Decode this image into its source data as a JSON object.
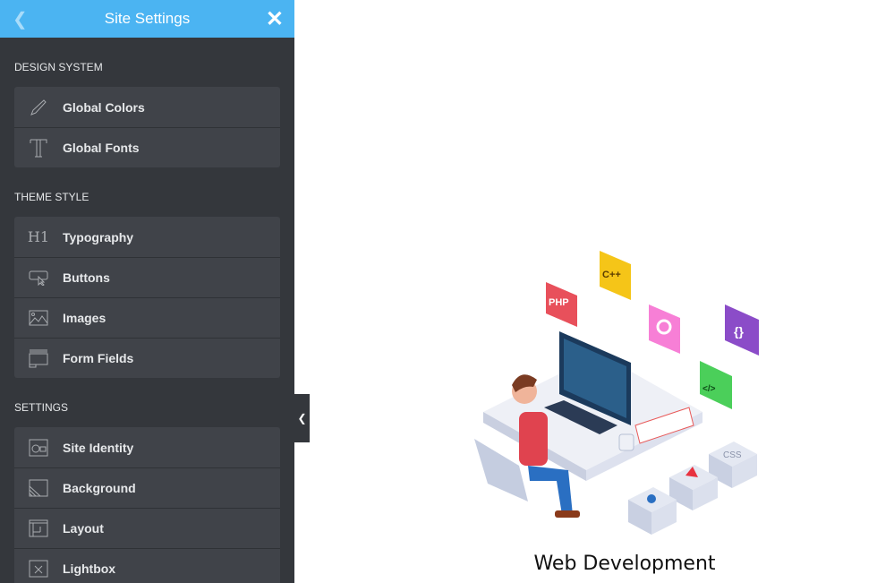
{
  "header": {
    "title": "Site Settings",
    "back_icon": "chevron-left-icon",
    "close_icon": "close-icon"
  },
  "sections": [
    {
      "title": "DESIGN SYSTEM",
      "items": [
        {
          "label": "Global Colors",
          "icon": "brush-icon"
        },
        {
          "label": "Global Fonts",
          "icon": "typeface-icon"
        }
      ]
    },
    {
      "title": "THEME STYLE",
      "items": [
        {
          "label": "Typography",
          "icon": "h1-icon"
        },
        {
          "label": "Buttons",
          "icon": "button-cursor-icon"
        },
        {
          "label": "Images",
          "icon": "image-icon"
        },
        {
          "label": "Form Fields",
          "icon": "form-field-icon"
        }
      ]
    },
    {
      "title": "SETTINGS",
      "items": [
        {
          "label": "Site Identity",
          "icon": "id-card-icon"
        },
        {
          "label": "Background",
          "icon": "background-icon"
        },
        {
          "label": "Layout",
          "icon": "layout-icon"
        },
        {
          "label": "Lightbox",
          "icon": "lightbox-icon"
        }
      ]
    }
  ],
  "main": {
    "caption": "Web Development",
    "illustration_labels": [
      "PHP",
      "C++",
      "{}",
      "</>",
      "CSS"
    ]
  },
  "colors": {
    "header": "#4bb4f2",
    "panel": "#34373c",
    "item": "#404349"
  }
}
